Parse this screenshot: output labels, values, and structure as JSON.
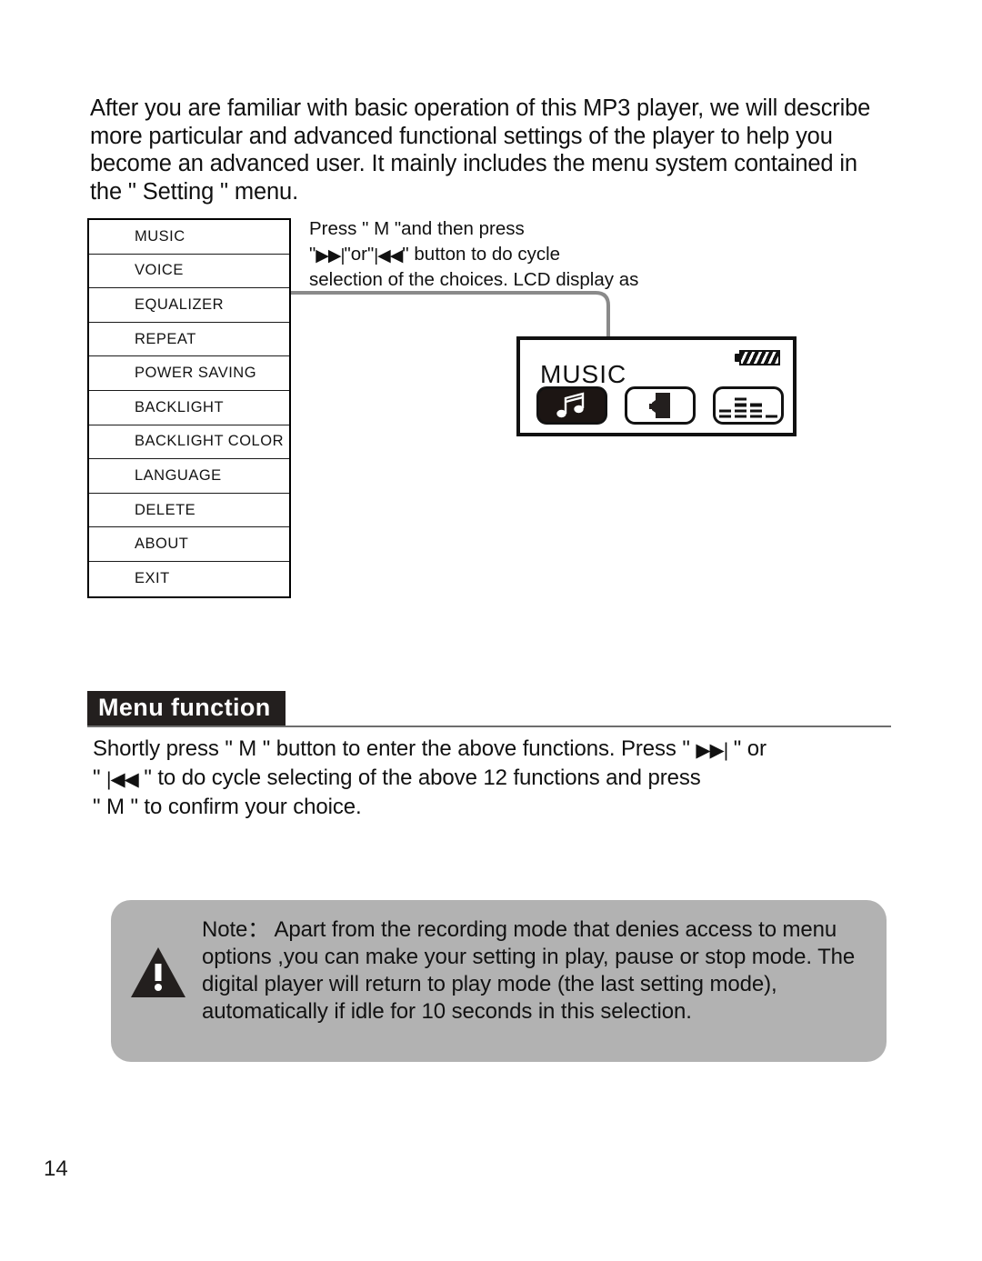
{
  "page": {
    "number": "14"
  },
  "intro": {
    "text": "After you are familiar with basic operation of this MP3 player, we will describe more particular and advanced functional settings of the player to help you become an advanced user. It mainly includes the menu system contained in the \" Setting \" menu."
  },
  "menu_table": {
    "rows": [
      {
        "label": "MUSIC"
      },
      {
        "label": "VOICE"
      },
      {
        "label": "EQUALIZER"
      },
      {
        "label": "REPEAT"
      },
      {
        "label": "POWER SAVING"
      },
      {
        "label": "BACKLIGHT"
      },
      {
        "label": "BACKLIGHT COLOR"
      },
      {
        "label": "LANGUAGE"
      },
      {
        "label": "DELETE"
      },
      {
        "label": "ABOUT"
      },
      {
        "label": "EXIT"
      }
    ]
  },
  "press_note": {
    "line1": "Press \" M \"and then press",
    "quote_open": "\"",
    "forward_glyph": "▶▶|",
    "between": "\"or\"",
    "rewind_glyph": "|◀◀",
    "quote_close": "\"",
    "line2_tail": " button to do cycle",
    "line3": "selection of the choices. LCD display as"
  },
  "lcd": {
    "title": "MUSIC",
    "battery_icon": "battery-full-icon",
    "icons": [
      {
        "name": "music-note-icon",
        "selected": true
      },
      {
        "name": "voice-microphone-icon",
        "selected": false
      },
      {
        "name": "equalizer-icon",
        "selected": false
      }
    ],
    "equalizer_bars": [
      2,
      4,
      3,
      1
    ]
  },
  "section": {
    "heading": "Menu function"
  },
  "body_para": {
    "part1": "Shortly press \" M \" button to enter the above functions. Press \" ",
    "forward_glyph": "▶▶|",
    "part2": " \" or",
    "part3": "\" ",
    "rewind_glyph": "|◀◀",
    "part4": " \"  to do cycle selecting of the above 12 functions and press",
    "part5": "\" M \" to confirm your choice."
  },
  "note": {
    "icon": "warning-triangle-icon",
    "text": "Note： Apart from the recording mode that denies access to menu options ,you can make your setting in play, pause or stop mode. The digital player will return to play mode (the last setting mode), automatically if idle for 10 seconds in this selection."
  },
  "colors": {
    "note_background": "#b2b2b2",
    "heading_background": "#231f1e",
    "ink": "#111111",
    "rule": "#6e6e6e",
    "connector": "#8a8a8a"
  }
}
